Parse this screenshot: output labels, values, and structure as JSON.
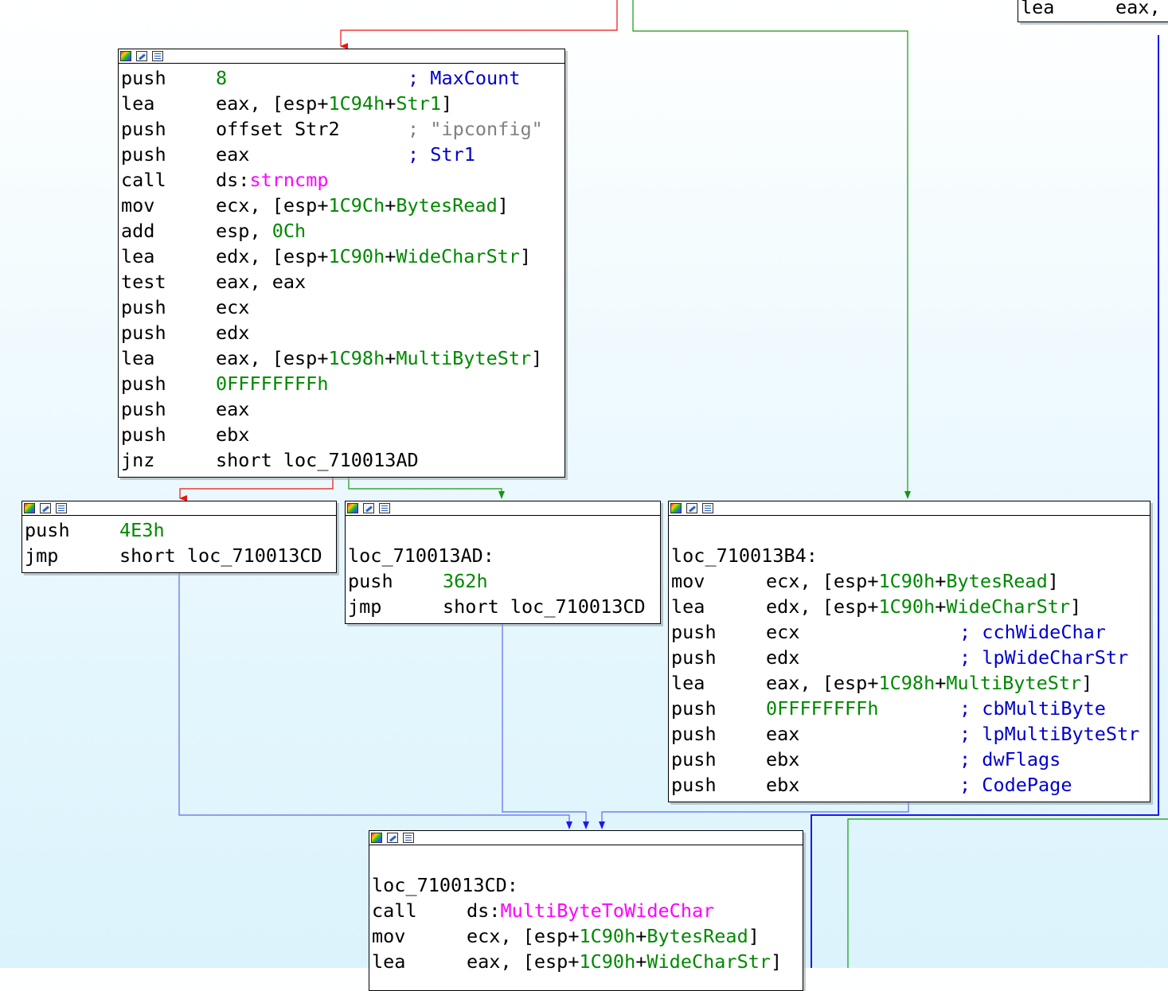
{
  "colors": {
    "edge_true": "#119911",
    "edge_false": "#ee1111",
    "edge_jump": "#1a1aee",
    "edge_jump_light": "#5a6cf0",
    "immediate": "#008800",
    "comment": "#0000cc",
    "string_comment": "#808080",
    "import": "#ff00ff"
  },
  "icons": [
    "graph-overview-icon",
    "edit-icon",
    "list-icon"
  ],
  "blocks": {
    "top_right": {
      "lines": [
        {
          "mnem": "lea",
          "ops": [
            {
              "t": "eax,",
              "c": "txt"
            }
          ]
        }
      ]
    },
    "main": {
      "lines": [
        {
          "mnem": "push",
          "ops": [
            {
              "t": "8",
              "c": "green"
            }
          ],
          "comment": "; MaxCount",
          "ccls": "blue"
        },
        {
          "mnem": "lea",
          "ops": [
            {
              "t": "eax, [esp+",
              "c": "txt"
            },
            {
              "t": "1C94h",
              "c": "green"
            },
            {
              "t": "+",
              "c": "txt"
            },
            {
              "t": "Str1",
              "c": "green"
            },
            {
              "t": "]",
              "c": "txt"
            }
          ]
        },
        {
          "mnem": "push",
          "ops": [
            {
              "t": "offset Str2",
              "c": "txt"
            }
          ],
          "comment": "; \"ipconfig\"",
          "ccls": "gray"
        },
        {
          "mnem": "push",
          "ops": [
            {
              "t": "eax",
              "c": "txt"
            }
          ],
          "comment": "; Str1",
          "ccls": "blue"
        },
        {
          "mnem": "call",
          "ops": [
            {
              "t": "ds:",
              "c": "txt"
            },
            {
              "t": "strncmp",
              "c": "mag"
            }
          ]
        },
        {
          "mnem": "mov",
          "ops": [
            {
              "t": "ecx, [esp+",
              "c": "txt"
            },
            {
              "t": "1C9Ch",
              "c": "green"
            },
            {
              "t": "+",
              "c": "txt"
            },
            {
              "t": "BytesRead",
              "c": "green"
            },
            {
              "t": "]",
              "c": "txt"
            }
          ]
        },
        {
          "mnem": "add",
          "ops": [
            {
              "t": "esp, ",
              "c": "txt"
            },
            {
              "t": "0Ch",
              "c": "green"
            }
          ]
        },
        {
          "mnem": "lea",
          "ops": [
            {
              "t": "edx, [esp+",
              "c": "txt"
            },
            {
              "t": "1C90h",
              "c": "green"
            },
            {
              "t": "+",
              "c": "txt"
            },
            {
              "t": "WideCharStr",
              "c": "green"
            },
            {
              "t": "]",
              "c": "txt"
            }
          ]
        },
        {
          "mnem": "test",
          "ops": [
            {
              "t": "eax, eax",
              "c": "txt"
            }
          ]
        },
        {
          "mnem": "push",
          "ops": [
            {
              "t": "ecx",
              "c": "txt"
            }
          ]
        },
        {
          "mnem": "push",
          "ops": [
            {
              "t": "edx",
              "c": "txt"
            }
          ]
        },
        {
          "mnem": "lea",
          "ops": [
            {
              "t": "eax, [esp+",
              "c": "txt"
            },
            {
              "t": "1C98h",
              "c": "green"
            },
            {
              "t": "+",
              "c": "txt"
            },
            {
              "t": "MultiByteStr",
              "c": "green"
            },
            {
              "t": "]",
              "c": "txt"
            }
          ]
        },
        {
          "mnem": "push",
          "ops": [
            {
              "t": "0FFFFFFFFh",
              "c": "green"
            }
          ]
        },
        {
          "mnem": "push",
          "ops": [
            {
              "t": "eax",
              "c": "txt"
            }
          ]
        },
        {
          "mnem": "push",
          "ops": [
            {
              "t": "ebx",
              "c": "txt"
            }
          ]
        },
        {
          "mnem": "jnz",
          "ops": [
            {
              "t": "short loc_710013AD",
              "c": "txt"
            }
          ]
        }
      ]
    },
    "left": {
      "lines": [
        {
          "mnem": "push",
          "ops": [
            {
              "t": "4E3h",
              "c": "green"
            }
          ]
        },
        {
          "mnem": "jmp",
          "ops": [
            {
              "t": "short loc_710013CD",
              "c": "txt"
            }
          ]
        }
      ]
    },
    "middle": {
      "lines": [
        {
          "label": ""
        },
        {
          "label": "loc_710013AD:"
        },
        {
          "mnem": "push",
          "ops": [
            {
              "t": "362h",
              "c": "green"
            }
          ]
        },
        {
          "mnem": "jmp",
          "ops": [
            {
              "t": "short loc_710013CD",
              "c": "txt"
            }
          ]
        }
      ]
    },
    "right": {
      "lines": [
        {
          "label": ""
        },
        {
          "label": "loc_710013B4:"
        },
        {
          "mnem": "mov",
          "ops": [
            {
              "t": "ecx, [esp+",
              "c": "txt"
            },
            {
              "t": "1C90h",
              "c": "green"
            },
            {
              "t": "+",
              "c": "txt"
            },
            {
              "t": "BytesRead",
              "c": "green"
            },
            {
              "t": "]",
              "c": "txt"
            }
          ]
        },
        {
          "mnem": "lea",
          "ops": [
            {
              "t": "edx, [esp+",
              "c": "txt"
            },
            {
              "t": "1C90h",
              "c": "green"
            },
            {
              "t": "+",
              "c": "txt"
            },
            {
              "t": "WideCharStr",
              "c": "green"
            },
            {
              "t": "]",
              "c": "txt"
            }
          ]
        },
        {
          "mnem": "push",
          "ops": [
            {
              "t": "ecx",
              "c": "txt"
            }
          ],
          "comment": "; cchWideChar",
          "ccls": "blue"
        },
        {
          "mnem": "push",
          "ops": [
            {
              "t": "edx",
              "c": "txt"
            }
          ],
          "comment": "; lpWideCharStr",
          "ccls": "blue"
        },
        {
          "mnem": "lea",
          "ops": [
            {
              "t": "eax, [esp+",
              "c": "txt"
            },
            {
              "t": "1C98h",
              "c": "green"
            },
            {
              "t": "+",
              "c": "txt"
            },
            {
              "t": "MultiByteStr",
              "c": "green"
            },
            {
              "t": "]",
              "c": "txt"
            }
          ]
        },
        {
          "mnem": "push",
          "ops": [
            {
              "t": "0FFFFFFFFh",
              "c": "green"
            }
          ],
          "comment": "; cbMultiByte",
          "ccls": "blue"
        },
        {
          "mnem": "push",
          "ops": [
            {
              "t": "eax",
              "c": "txt"
            }
          ],
          "comment": "; lpMultiByteStr",
          "ccls": "blue"
        },
        {
          "mnem": "push",
          "ops": [
            {
              "t": "ebx",
              "c": "txt"
            }
          ],
          "comment": "; dwFlags",
          "ccls": "blue"
        },
        {
          "mnem": "push",
          "ops": [
            {
              "t": "ebx",
              "c": "txt"
            }
          ],
          "comment": "; CodePage",
          "ccls": "blue"
        }
      ]
    },
    "bottom": {
      "lines": [
        {
          "label": ""
        },
        {
          "label": "loc_710013CD:"
        },
        {
          "mnem": "call",
          "ops": [
            {
              "t": "ds:",
              "c": "txt"
            },
            {
              "t": "MultiByteToWideChar",
              "c": "mag"
            }
          ]
        },
        {
          "mnem": "mov",
          "ops": [
            {
              "t": "ecx, [esp+",
              "c": "txt"
            },
            {
              "t": "1C90h",
              "c": "green"
            },
            {
              "t": "+",
              "c": "txt"
            },
            {
              "t": "BytesRead",
              "c": "green"
            },
            {
              "t": "]",
              "c": "txt"
            }
          ]
        },
        {
          "mnem": "lea",
          "ops": [
            {
              "t": "eax, [esp+",
              "c": "txt"
            },
            {
              "t": "1C90h",
              "c": "green"
            },
            {
              "t": "+",
              "c": "txt"
            },
            {
              "t": "WideCharStr",
              "c": "green"
            },
            {
              "t": "]",
              "c": "txt"
            }
          ]
        }
      ]
    }
  }
}
